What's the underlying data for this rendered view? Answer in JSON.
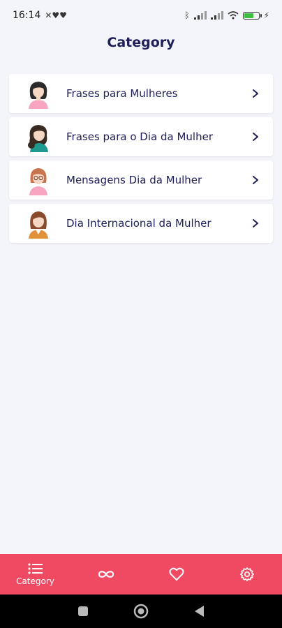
{
  "status_bar": {
    "time": "16:14"
  },
  "header": {
    "title": "Category"
  },
  "categories": [
    {
      "label": "Frases para Mulheres",
      "icon": "woman-avatar-icon"
    },
    {
      "label": "Frases para o Dia da Mulher",
      "icon": "woman-avatar-icon"
    },
    {
      "label": "Mensagens Dia da Mulher",
      "icon": "woman-avatar-icon"
    },
    {
      "label": "Dia Internacional da Mulher",
      "icon": "woman-avatar-icon"
    }
  ],
  "bottom_nav": {
    "items": [
      {
        "label": "Category",
        "icon": "list-icon",
        "active": true
      },
      {
        "label": "",
        "icon": "infinity-icon"
      },
      {
        "label": "",
        "icon": "heart-icon"
      },
      {
        "label": "",
        "icon": "gear-icon"
      }
    ],
    "color": "#f04a63"
  },
  "colors": {
    "background": "#f4f5fa",
    "text": "#1d1e5a"
  }
}
